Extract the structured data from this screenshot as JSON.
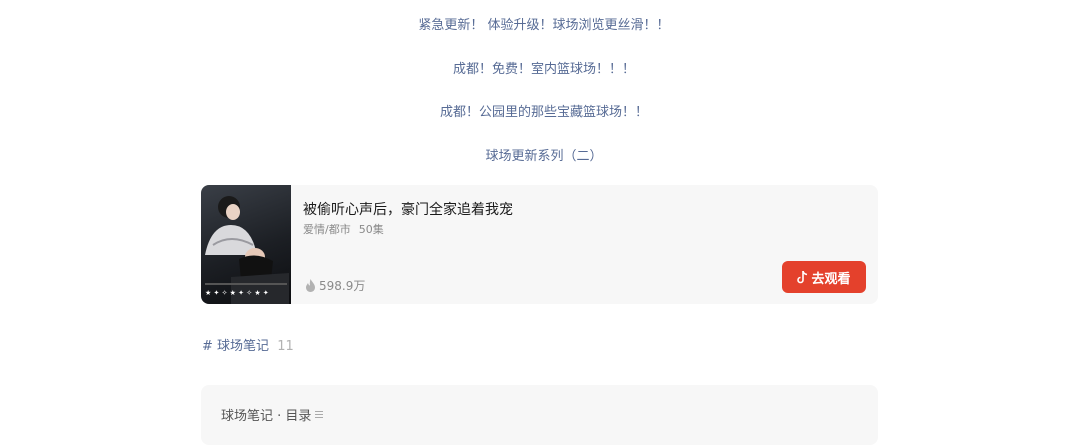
{
  "links": [
    "紧急更新！ 体验升级！球场浏览更丝滑！！",
    "成都！免费！室内篮球场！！！",
    "成都！公园里的那些宝藏篮球场！！",
    "球场更新系列（二）"
  ],
  "drama": {
    "title": "被偷听心声后，豪门全家追着我宠",
    "genre": "爱情/都市",
    "episodes": "50集",
    "views": "598.9万",
    "watch_label": "去观看"
  },
  "tag": {
    "hash": "#",
    "label": "球场笔记",
    "count": "11"
  },
  "toc": {
    "title": "球场笔记 · 目录"
  },
  "colors": {
    "link": "#576b95",
    "watch_button": "#e4412c",
    "card_bg": "#f7f7f7"
  }
}
